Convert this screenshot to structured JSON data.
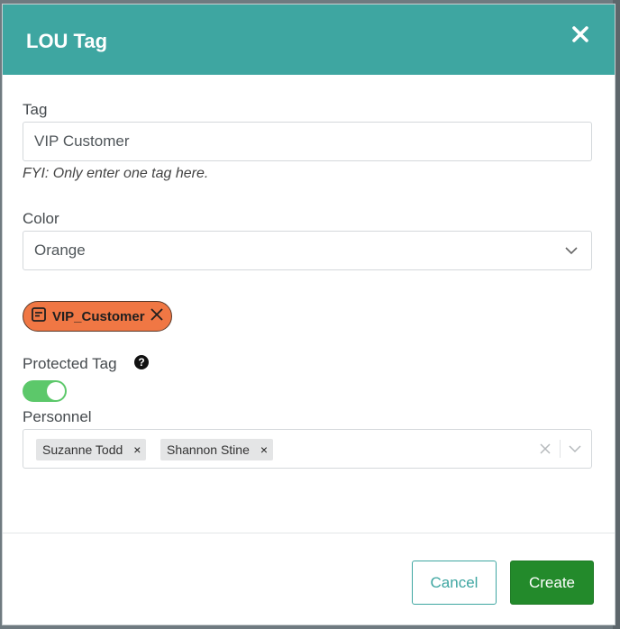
{
  "dialog": {
    "title": "LOU Tag"
  },
  "tag_field": {
    "label": "Tag",
    "value": "VIP Customer",
    "hint": "FYI: Only enter one tag here."
  },
  "color_field": {
    "label": "Color",
    "selected": "Orange"
  },
  "preview_tag": {
    "label": "VIP_Customer",
    "color": "#f07744"
  },
  "protected": {
    "label": "Protected Tag",
    "enabled": true
  },
  "personnel": {
    "label": "Personnel",
    "selected": [
      "Suzanne Todd",
      "Shannon Stine"
    ]
  },
  "footer": {
    "cancel_label": "Cancel",
    "create_label": "Create"
  },
  "colors": {
    "header": "#3ea6a1",
    "create": "#238a2b",
    "toggle_on": "#5cc86a"
  },
  "icons": {
    "close": "close-icon",
    "help": "help-icon",
    "chevron": "chevron-down-icon",
    "note": "note-icon"
  }
}
